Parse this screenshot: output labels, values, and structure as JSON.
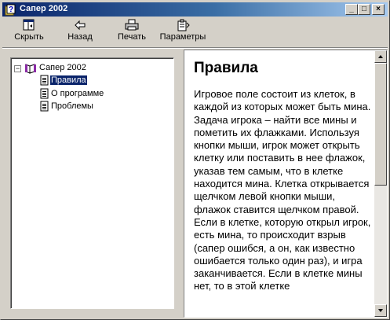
{
  "window": {
    "title": "Сапер 2002",
    "controls": {
      "minimize": "_",
      "maximize": "□",
      "close": "×"
    }
  },
  "toolbar": {
    "hide_label": "Скрыть",
    "back_label": "Назад",
    "print_label": "Печать",
    "options_label": "Параметры"
  },
  "tree": {
    "expander": "−",
    "root": "Сапер 2002",
    "items": [
      {
        "label": "Правила",
        "selected": true
      },
      {
        "label": "О программе",
        "selected": false
      },
      {
        "label": "Проблемы",
        "selected": false
      }
    ]
  },
  "content": {
    "heading": "Правила",
    "body": "Игровое поле состоит из клеток, в каждой из которых может быть мина. Задача игрока – найти все мины и пометить их флажками. Используя кнопки мыши, игрок может открыть клетку или поставить в нее флажок, указав тем самым, что в клетке находится мина. Клетка открывается щелчком левой кнопки мыши, флажок ставится щелчком правой. Если в клетке, которую открыл игрок, есть мина, то происходит взрыв (сапер ошибся, а он, как известно ошибается только один раз), и игра заканчивается. Если в клетке мины нет, то в этой клетке"
  },
  "colors": {
    "title_bar_start": "#0a246a",
    "title_bar_end": "#a6caf0",
    "selection": "#0a246a",
    "window_face": "#d4d0c8"
  },
  "icons": {
    "app": "help-book-icon",
    "hide": "hide-pane-icon",
    "back": "back-arrow-icon",
    "print": "printer-icon",
    "options": "options-icon",
    "root": "book-icon",
    "page": "page-icon"
  }
}
